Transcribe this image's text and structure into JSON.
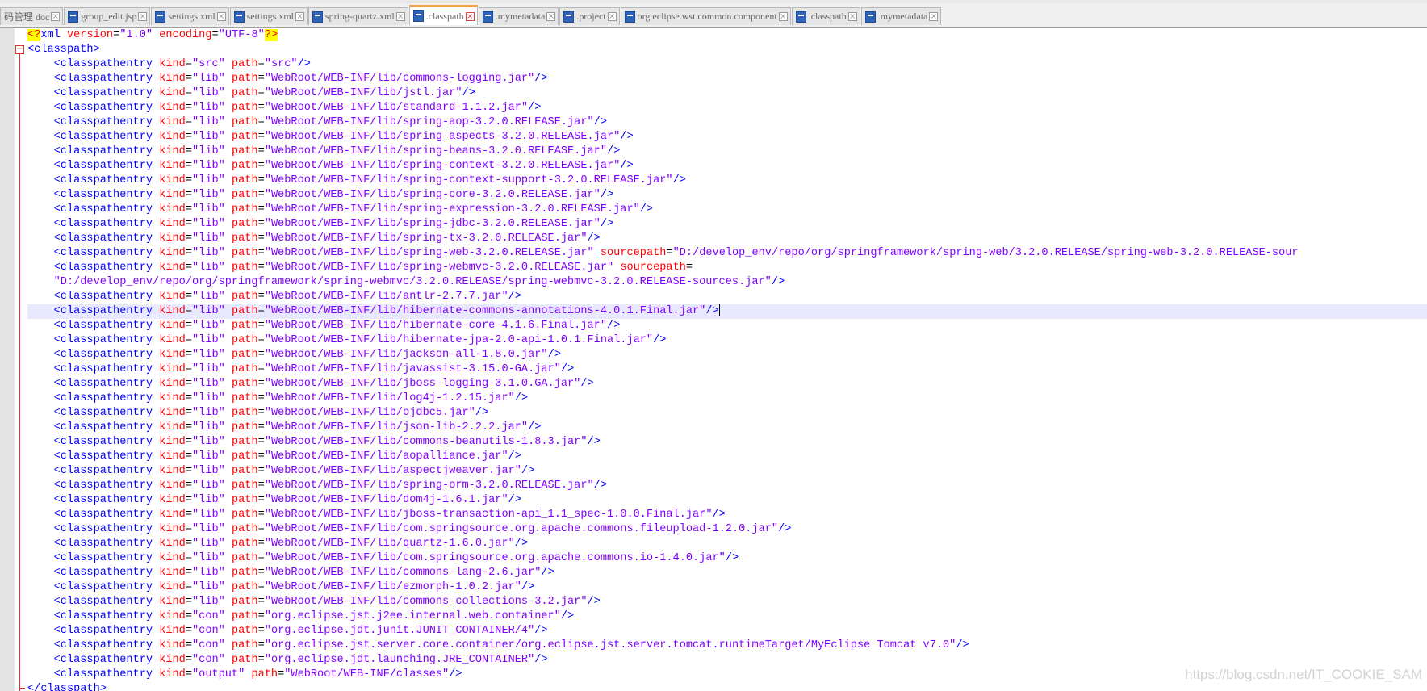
{
  "tabs": [
    {
      "label": "码管理 doc",
      "icon": "file-icon",
      "active": false,
      "close": "close-icon"
    },
    {
      "label": "group_edit.jsp",
      "icon": "file-icon",
      "active": false
    },
    {
      "label": "settings.xml",
      "icon": "file-icon",
      "active": false
    },
    {
      "label": "settings.xml",
      "icon": "file-icon",
      "active": false
    },
    {
      "label": "spring-quartz.xml",
      "icon": "file-icon",
      "active": false
    },
    {
      "label": ".classpath",
      "icon": "file-icon",
      "active": true
    },
    {
      "label": ".mymetadata",
      "icon": "file-icon",
      "active": false
    },
    {
      "label": ".project",
      "icon": "file-icon",
      "active": false
    },
    {
      "label": "org.eclipse.wst.common.component",
      "icon": "file-icon",
      "active": false
    },
    {
      "label": ".classpath",
      "icon": "file-icon",
      "active": false
    },
    {
      "label": ".mymetadata",
      "icon": "file-icon",
      "active": false
    }
  ],
  "editor": {
    "lines": [
      "<?xml version=\"1.0\" encoding=\"UTF-8\"?>",
      "<classpath>",
      "    <classpathentry kind=\"src\" path=\"src\"/>",
      "    <classpathentry kind=\"lib\" path=\"WebRoot/WEB-INF/lib/commons-logging.jar\"/>",
      "    <classpathentry kind=\"lib\" path=\"WebRoot/WEB-INF/lib/jstl.jar\"/>",
      "    <classpathentry kind=\"lib\" path=\"WebRoot/WEB-INF/lib/standard-1.1.2.jar\"/>",
      "    <classpathentry kind=\"lib\" path=\"WebRoot/WEB-INF/lib/spring-aop-3.2.0.RELEASE.jar\"/>",
      "    <classpathentry kind=\"lib\" path=\"WebRoot/WEB-INF/lib/spring-aspects-3.2.0.RELEASE.jar\"/>",
      "    <classpathentry kind=\"lib\" path=\"WebRoot/WEB-INF/lib/spring-beans-3.2.0.RELEASE.jar\"/>",
      "    <classpathentry kind=\"lib\" path=\"WebRoot/WEB-INF/lib/spring-context-3.2.0.RELEASE.jar\"/>",
      "    <classpathentry kind=\"lib\" path=\"WebRoot/WEB-INF/lib/spring-context-support-3.2.0.RELEASE.jar\"/>",
      "    <classpathentry kind=\"lib\" path=\"WebRoot/WEB-INF/lib/spring-core-3.2.0.RELEASE.jar\"/>",
      "    <classpathentry kind=\"lib\" path=\"WebRoot/WEB-INF/lib/spring-expression-3.2.0.RELEASE.jar\"/>",
      "    <classpathentry kind=\"lib\" path=\"WebRoot/WEB-INF/lib/spring-jdbc-3.2.0.RELEASE.jar\"/>",
      "    <classpathentry kind=\"lib\" path=\"WebRoot/WEB-INF/lib/spring-tx-3.2.0.RELEASE.jar\"/>",
      "    <classpathentry kind=\"lib\" path=\"WebRoot/WEB-INF/lib/spring-web-3.2.0.RELEASE.jar\" sourcepath=\"D:/develop_env/repo/org/springframework/spring-web/3.2.0.RELEASE/spring-web-3.2.0.RELEASE-sour",
      "    <classpathentry kind=\"lib\" path=\"WebRoot/WEB-INF/lib/spring-webmvc-3.2.0.RELEASE.jar\" sourcepath=",
      "    \"D:/develop_env/repo/org/springframework/spring-webmvc/3.2.0.RELEASE/spring-webmvc-3.2.0.RELEASE-sources.jar\"/>",
      "    <classpathentry kind=\"lib\" path=\"WebRoot/WEB-INF/lib/antlr-2.7.7.jar\"/>",
      "    <classpathentry kind=\"lib\" path=\"WebRoot/WEB-INF/lib/hibernate-commons-annotations-4.0.1.Final.jar\"/>",
      "    <classpathentry kind=\"lib\" path=\"WebRoot/WEB-INF/lib/hibernate-core-4.1.6.Final.jar\"/>",
      "    <classpathentry kind=\"lib\" path=\"WebRoot/WEB-INF/lib/hibernate-jpa-2.0-api-1.0.1.Final.jar\"/>",
      "    <classpathentry kind=\"lib\" path=\"WebRoot/WEB-INF/lib/jackson-all-1.8.0.jar\"/>",
      "    <classpathentry kind=\"lib\" path=\"WebRoot/WEB-INF/lib/javassist-3.15.0-GA.jar\"/>",
      "    <classpathentry kind=\"lib\" path=\"WebRoot/WEB-INF/lib/jboss-logging-3.1.0.GA.jar\"/>",
      "    <classpathentry kind=\"lib\" path=\"WebRoot/WEB-INF/lib/log4j-1.2.15.jar\"/>",
      "    <classpathentry kind=\"lib\" path=\"WebRoot/WEB-INF/lib/ojdbc5.jar\"/>",
      "    <classpathentry kind=\"lib\" path=\"WebRoot/WEB-INF/lib/json-lib-2.2.2.jar\"/>",
      "    <classpathentry kind=\"lib\" path=\"WebRoot/WEB-INF/lib/commons-beanutils-1.8.3.jar\"/>",
      "    <classpathentry kind=\"lib\" path=\"WebRoot/WEB-INF/lib/aopalliance.jar\"/>",
      "    <classpathentry kind=\"lib\" path=\"WebRoot/WEB-INF/lib/aspectjweaver.jar\"/>",
      "    <classpathentry kind=\"lib\" path=\"WebRoot/WEB-INF/lib/spring-orm-3.2.0.RELEASE.jar\"/>",
      "    <classpathentry kind=\"lib\" path=\"WebRoot/WEB-INF/lib/dom4j-1.6.1.jar\"/>",
      "    <classpathentry kind=\"lib\" path=\"WebRoot/WEB-INF/lib/jboss-transaction-api_1.1_spec-1.0.0.Final.jar\"/>",
      "    <classpathentry kind=\"lib\" path=\"WebRoot/WEB-INF/lib/com.springsource.org.apache.commons.fileupload-1.2.0.jar\"/>",
      "    <classpathentry kind=\"lib\" path=\"WebRoot/WEB-INF/lib/quartz-1.6.0.jar\"/>",
      "    <classpathentry kind=\"lib\" path=\"WebRoot/WEB-INF/lib/com.springsource.org.apache.commons.io-1.4.0.jar\"/>",
      "    <classpathentry kind=\"lib\" path=\"WebRoot/WEB-INF/lib/commons-lang-2.6.jar\"/>",
      "    <classpathentry kind=\"lib\" path=\"WebRoot/WEB-INF/lib/ezmorph-1.0.2.jar\"/>",
      "    <classpathentry kind=\"lib\" path=\"WebRoot/WEB-INF/lib/commons-collections-3.2.jar\"/>",
      "    <classpathentry kind=\"con\" path=\"org.eclipse.jst.j2ee.internal.web.container\"/>",
      "    <classpathentry kind=\"con\" path=\"org.eclipse.jdt.junit.JUNIT_CONTAINER/4\"/>",
      "    <classpathentry kind=\"con\" path=\"org.eclipse.jst.server.core.container/org.eclipse.jst.server.tomcat.runtimeTarget/MyEclipse Tomcat v7.0\"/>",
      "    <classpathentry kind=\"con\" path=\"org.eclipse.jdt.launching.JRE_CONTAINER\"/>",
      "    <classpathentry kind=\"output\" path=\"WebRoot/WEB-INF/classes\"/>",
      "</classpath>"
    ],
    "current_line": 19
  },
  "watermark": "https://blog.csdn.net/IT_COOKIE_SAM",
  "colors": {
    "tag": "#0000ff",
    "attribute": "#ff0000",
    "value": "#8000ff",
    "current_line": "#e8e8ff",
    "active_tab_accent": "#f5a142",
    "fold_marker": "#e03030"
  }
}
